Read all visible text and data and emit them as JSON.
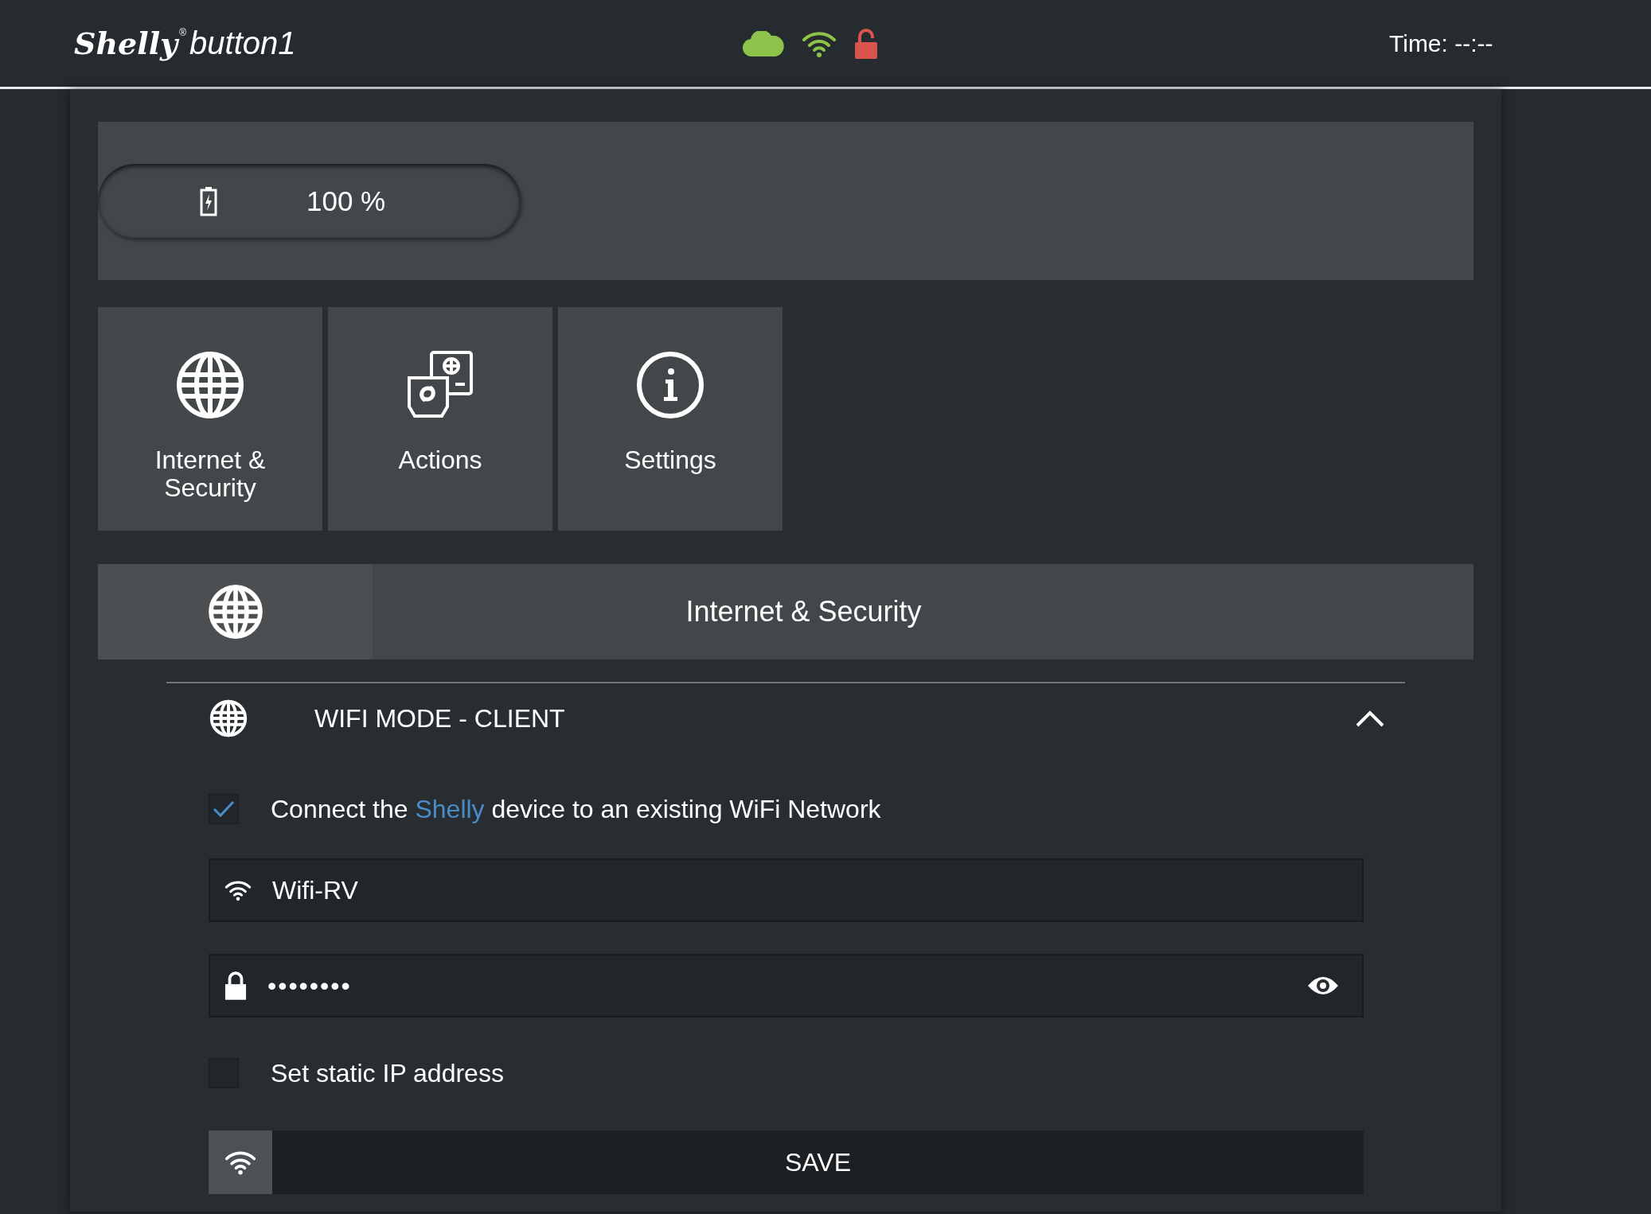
{
  "header": {
    "logo": {
      "brand": "Shelly",
      "mark": "®",
      "model": "button1"
    },
    "status": [
      {
        "kind": "cloud",
        "on": true
      },
      {
        "kind": "wifi",
        "on": true
      },
      {
        "kind": "lock",
        "on": false
      }
    ],
    "time": "Time: --:--"
  },
  "battery": {
    "reading": "100 %"
  },
  "tiles": [
    {
      "kind": "globe",
      "label": "Internet & Security"
    },
    {
      "kind": "actions",
      "label": "Actions"
    },
    {
      "kind": "info",
      "label": "Settings"
    }
  ],
  "section": {
    "title": "Internet & Security"
  },
  "panel": {
    "title": "WIFI MODE - CLIENT",
    "expanded": true,
    "connect": {
      "checked": true,
      "before": "Connect the",
      "link": "Shelly",
      "after": "device to an existing WiFi Network"
    },
    "ssid": {
      "value": "Wifi-RV"
    },
    "password": {
      "value": "••••••••"
    },
    "static_ip": {
      "checked": false,
      "label": "Set static IP address"
    },
    "save": "SAVE"
  }
}
